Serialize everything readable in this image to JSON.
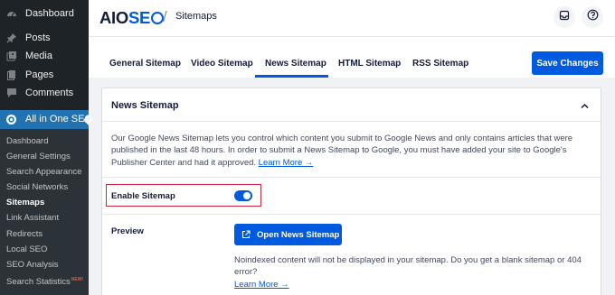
{
  "sidebar": {
    "menu": [
      {
        "label": "Dashboard",
        "icon": "dashboard-icon"
      },
      {
        "label": "Posts",
        "icon": "pin-icon"
      },
      {
        "label": "Media",
        "icon": "media-icon"
      },
      {
        "label": "Pages",
        "icon": "pages-icon"
      },
      {
        "label": "Comments",
        "icon": "comment-icon"
      }
    ],
    "active_menu": {
      "label": "All in One SEO",
      "icon": "aioseo-gear-icon"
    },
    "submenu": [
      {
        "label": "Dashboard"
      },
      {
        "label": "General Settings"
      },
      {
        "label": "Search Appearance"
      },
      {
        "label": "Social Networks"
      },
      {
        "label": "Sitemaps"
      },
      {
        "label": "Link Assistant"
      },
      {
        "label": "Redirects"
      },
      {
        "label": "Local SEO"
      },
      {
        "label": "SEO Analysis"
      },
      {
        "label": "Search Statistics",
        "badge": "NEW!"
      }
    ],
    "current_submenu": "Sitemaps"
  },
  "header": {
    "logo_text_dark": "AIO",
    "logo_text_blue": "SE",
    "breadcrumb_separator": "/",
    "breadcrumb": "Sitemaps",
    "inbox_icon": "inbox-icon",
    "help_icon": "help-icon"
  },
  "tabs": [
    {
      "label": "General Sitemap"
    },
    {
      "label": "Video Sitemap"
    },
    {
      "label": "News Sitemap"
    },
    {
      "label": "HTML Sitemap"
    },
    {
      "label": "RSS Sitemap"
    }
  ],
  "active_tab": "News Sitemap",
  "save_button": "Save Changes",
  "card": {
    "title": "News Sitemap",
    "description": "Our Google News Sitemap lets you control which content you submit to Google News and only contains articles that were published in the last 48 hours. In order to submit a News Sitemap to Google, you must have added your site to Google's Publisher Center and had it approved.",
    "learn_more": "Learn More →",
    "enable_label": "Enable Sitemap",
    "enable_value": true,
    "preview_label": "Preview",
    "open_button": "Open News Sitemap",
    "noindex_text": "Noindexed content will not be displayed in your sitemap. Do you get a blank sitemap or 404 error?",
    "noindex_link": "Learn More →"
  },
  "colors": {
    "accent": "#005ae0",
    "sidebar_bg": "#1d2327",
    "sidebar_active": "#2271b1",
    "highlight_border": "#c9233e"
  }
}
